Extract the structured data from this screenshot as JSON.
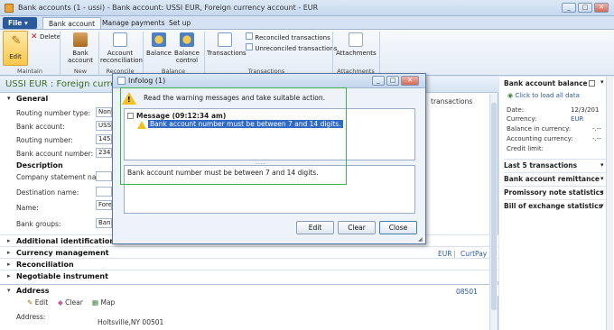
{
  "window": {
    "title": "Bank accounts (1 - ussi) - Bank account: USSI EUR, Foreign currency account - EUR",
    "min_label": "_",
    "max_label": "□",
    "close_label": "✕"
  },
  "ribbon": {
    "file_label": "File",
    "tabs": [
      "Bank account",
      "Manage payments",
      "Set up"
    ],
    "edit_label": "Edit",
    "delete_label": "Delete",
    "bank_account_label": "Bank account",
    "account_reconciliation_label": "Account reconciliation",
    "balance_label": "Balance",
    "balance_control_label": "Balance control",
    "transactions_label": "Transactions",
    "reconciled_label": "Reconciled transactions",
    "unreconciled_label": "Unreconciled transactions",
    "attachments_label": "Attachments",
    "groups": [
      "Maintain",
      "New",
      "Reconcile",
      "Balance",
      "Transactions",
      "Attachments"
    ]
  },
  "form": {
    "title": "USSI EUR : Foreign currency ac",
    "general": "General",
    "fields": [
      {
        "label": "Routing number type:",
        "value": "None"
      },
      {
        "label": "Bank account:",
        "value": "USSI"
      },
      {
        "label": "Routing number:",
        "value": "1458"
      },
      {
        "label": "Bank account number:",
        "value": "23456"
      }
    ],
    "description": "Description",
    "company_statement_name": "Company statement name:",
    "destination_name": "Destination name:",
    "name_label": "Name:",
    "name_value": "Forei",
    "bank_groups_label": "Bank groups:",
    "bank_groups_value": "Bank",
    "transactions_right": "transactions",
    "sections": [
      "Additional identification",
      "Currency management",
      "Reconciliation",
      "Negotiable instrument"
    ],
    "currency_summary": [
      "EUR",
      "CurtPay"
    ],
    "address": {
      "title": "Address",
      "id": "08501",
      "edit": "Edit",
      "clear": "Clear",
      "map": "Map",
      "address_label": "Address:",
      "address_value": "Holtsville,NY 00501"
    }
  },
  "right_pane": {
    "bank_balance_title": "Bank account balance",
    "load_link": "Click to load all data",
    "rows": [
      {
        "label": "Date:",
        "value": "12/3/201"
      },
      {
        "label": "Currency:",
        "value": "EUR"
      },
      {
        "label": "Balance in currency:",
        "value": "-.--"
      },
      {
        "label": "Accounting currency:",
        "value": "-.--"
      },
      {
        "label": "Credit limit:",
        "value": ""
      }
    ],
    "collapsed": [
      "Last 5 transactions",
      "Bank account remittance",
      "Promissory note statistics",
      "Bill of exchange statistics"
    ]
  },
  "infolog": {
    "title": "Infolog (1)",
    "instruction": "Read the warning messages and take suitable action.",
    "message_header": "Message (09:12:34 am)",
    "warning": "Bank account number must be between 7 and 14 digits.",
    "detail": "Bank account number must be between 7 and 14 digits.",
    "splitter": "....",
    "edit": "Edit",
    "clear": "Clear",
    "close": "Close"
  },
  "colors": {
    "accent": "#2b5a9c",
    "highlight": "#316ac5",
    "green_box": "#39b54a",
    "title_green": "#3b6d20"
  }
}
